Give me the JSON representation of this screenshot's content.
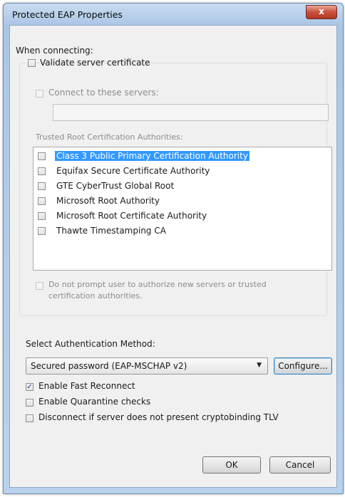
{
  "window": {
    "title": "Protected EAP Properties",
    "close_glyph": "x"
  },
  "connecting": {
    "heading": "When connecting:",
    "validate_cert": {
      "label": "Validate server certificate",
      "checked": false
    },
    "connect_servers": {
      "label": "Connect to these servers:",
      "checked": false,
      "value": ""
    },
    "trusted_label": "Trusted Root Certification Authorities:",
    "authorities": [
      {
        "label": "Class 3 Public Primary Certification Authority",
        "checked": false,
        "selected": true
      },
      {
        "label": "Equifax Secure Certificate Authority",
        "checked": false,
        "selected": false
      },
      {
        "label": "GTE CyberTrust Global Root",
        "checked": false,
        "selected": false
      },
      {
        "label": "Microsoft Root Authority",
        "checked": false,
        "selected": false
      },
      {
        "label": "Microsoft Root Certificate Authority",
        "checked": false,
        "selected": false
      },
      {
        "label": "Thawte Timestamping CA",
        "checked": false,
        "selected": false
      }
    ],
    "no_prompt": {
      "line1": "Do not prompt user to authorize new servers or trusted",
      "line2": "certification authorities.",
      "checked": false
    }
  },
  "auth": {
    "label": "Select Authentication Method:",
    "selected": "Secured password (EAP-MSCHAP v2)",
    "configure_label": "Configure..."
  },
  "options": {
    "fast_reconnect": {
      "label": "Enable Fast Reconnect",
      "checked": true
    },
    "quarantine": {
      "label": "Enable Quarantine checks",
      "checked": false
    },
    "disconnect": {
      "label": "Disconnect if server does not present cryptobinding TLV",
      "checked": false
    }
  },
  "buttons": {
    "ok": "OK",
    "cancel": "Cancel"
  },
  "colors": {
    "selection": "#3399ff",
    "title_bar": "#b9d1ec",
    "close_button": "#c9503c"
  }
}
